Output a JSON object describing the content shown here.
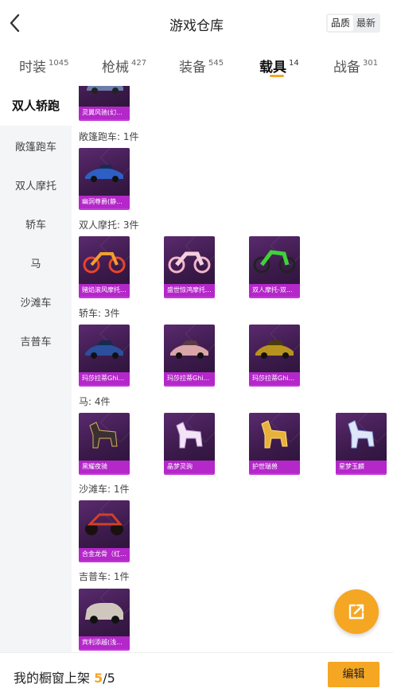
{
  "header": {
    "title": "游戏仓库",
    "sort": {
      "quality": "品质",
      "newest": "最新"
    }
  },
  "tabs": [
    {
      "label": "时装",
      "count": "1045"
    },
    {
      "label": "枪械",
      "count": "427"
    },
    {
      "label": "装备",
      "count": "545"
    },
    {
      "label": "载具",
      "count": "14"
    },
    {
      "label": "战备",
      "count": "301"
    }
  ],
  "sidebar": {
    "items": [
      "双人轿跑",
      "敞篷跑车",
      "双人摩托",
      "轿车",
      "马",
      "沙滩车",
      "吉普车"
    ]
  },
  "sections": [
    {
      "label": "",
      "items": [
        "灵翼风驰(幻..."
      ]
    },
    {
      "label": "敞篷跑车: 1件",
      "items": [
        "幽洞尊爵(静..."
      ]
    },
    {
      "label": "双人摩托: 3件",
      "items": [
        "赌焰滚风摩托...",
        "盛世惊鸿摩托...",
        "双人摩托-双..."
      ]
    },
    {
      "label": "轿车: 3件",
      "items": [
        "玛莎拉蒂Ghi...",
        "玛莎拉蒂Ghi...",
        "玛莎拉蒂Ghi..."
      ]
    },
    {
      "label": "马: 4件",
      "items": [
        "黑耀夜骑",
        "晶梦灵驹",
        "护世瑞兽",
        "星梦玉麟"
      ]
    },
    {
      "label": "沙滩车: 1件",
      "items": [
        "合金龙骨（红..."
      ]
    },
    {
      "label": "吉普车: 1件",
      "items": [
        "宾利添越(浅..."
      ]
    }
  ],
  "footer": {
    "text": "我的橱窗上架",
    "current": "5",
    "total": "/5",
    "edit_label": "编辑"
  },
  "colors": {
    "accent": "#f5a623",
    "card_bottom": "#b427c9"
  }
}
